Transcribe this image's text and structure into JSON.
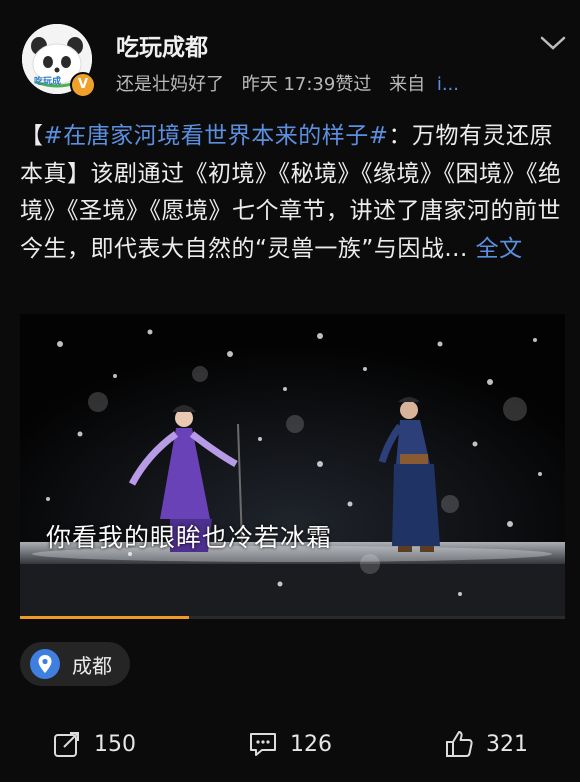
{
  "header": {
    "username": "吃玩成都",
    "avatar_caption": "吃玩成",
    "verified_badge": "V",
    "meta": {
      "account": "还是壮妈好了",
      "time": "昨天 17:39赞过",
      "source_prefix": "来自",
      "source_name": "i..."
    }
  },
  "post": {
    "open_bracket": "【",
    "topic": "#在唐家河境看世界本来的样子#",
    "text_after_topic": "：万物有灵还原本真】该剧通过《初境》《秘境》《缘境》《困境》《绝境》《圣境》《愿境》七个章节，讲述了唐家河的前世今生，即代表大自然的“灵兽一族”与因战...",
    "full_text_link": "全文"
  },
  "video": {
    "subtitle": "你看我的眼眸也冷若冰霜",
    "progress": 0.31
  },
  "location": {
    "label": "成都",
    "icon": "location-pin-icon"
  },
  "actions": {
    "share_count": "150",
    "comment_count": "126",
    "like_count": "321"
  },
  "colors": {
    "background": "#0b0b0b",
    "link_blue": "#5b8fe0",
    "progress_orange": "#f19a25"
  }
}
